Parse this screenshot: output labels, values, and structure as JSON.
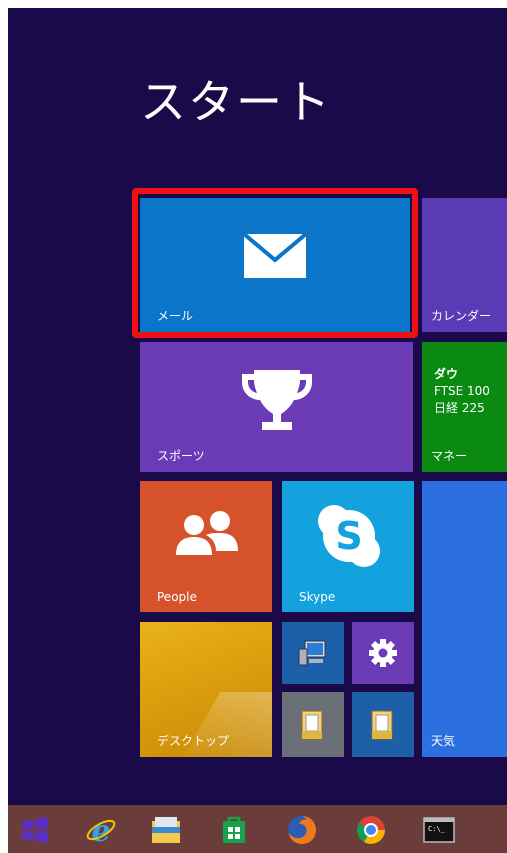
{
  "start_screen": {
    "title": "スタート"
  },
  "tiles": {
    "mail": {
      "label": "メール"
    },
    "calendar": {
      "label": "カレンダー"
    },
    "sports": {
      "label": "スポーツ"
    },
    "money": {
      "label": "マネー",
      "lines": [
        "ダウ",
        "FTSE 100",
        "日経 225"
      ]
    },
    "people": {
      "label": "People"
    },
    "skype": {
      "label": "Skype"
    },
    "weather": {
      "label": "天気"
    },
    "desktop": {
      "label": "デスクトップ"
    }
  },
  "mini_tiles": [
    "computer-icon",
    "settings-icon",
    "file-explorer-icon",
    "file-explorer-icon"
  ],
  "highlight": {
    "color": "#ee1111",
    "target": "mail"
  },
  "taskbar": {
    "icons": [
      "windows-start-icon",
      "internet-explorer-icon",
      "file-explorer-icon",
      "store-icon",
      "firefox-icon",
      "chrome-icon",
      "command-prompt-icon"
    ],
    "cmd_text": "C:\\_"
  }
}
